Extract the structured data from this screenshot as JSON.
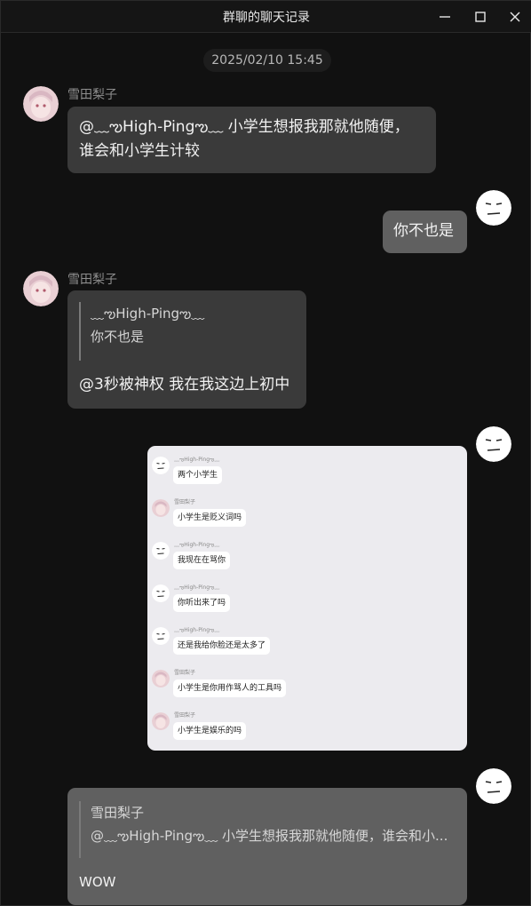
{
  "window": {
    "title": "群聊的聊天记录",
    "controls": {
      "minimize": "minimize-icon",
      "maximize": "maximize-icon",
      "close": "close-icon"
    }
  },
  "chat": {
    "timestamp": "2025/02/10 15:45",
    "messages": [
      {
        "sender": "雪田梨子",
        "line1": "@﹏ఌHigh-Pingఌ﹏ 小学生想报我那就他随便，",
        "line2": "谁会和小学生计较"
      },
      {
        "text": "你不也是"
      },
      {
        "sender": "雪田梨子",
        "quote_name": "﹏ఌHigh-Pingఌ﹏",
        "quote_text": "你不也是",
        "text": "@3秒被神权 我在我这边上初中"
      },
      {
        "screenshot": [
          {
            "name": "﹏ఌHigh-Pingఌ﹏",
            "text": "两个小学生",
            "avatar": "face-icon"
          },
          {
            "name": "雪田梨子",
            "text": "小学生是贬义词吗",
            "avatar": "anime-girl-avatar"
          },
          {
            "name": "﹏ఌHigh-Pingఌ﹏",
            "text": "我现在在骂你",
            "avatar": "face-icon"
          },
          {
            "name": "﹏ఌHigh-Pingఌ﹏",
            "text": "你听出来了吗",
            "avatar": "face-icon"
          },
          {
            "name": "﹏ఌHigh-Pingఌ﹏",
            "text": "还是我给你脸还是太多了",
            "avatar": "face-icon"
          },
          {
            "name": "雪田梨子",
            "text": "小学生是你用作骂人的工具吗",
            "avatar": "anime-girl-avatar"
          },
          {
            "name": "雪田梨子",
            "text": "小学生是娱乐的吗",
            "avatar": "anime-girl-avatar"
          }
        ]
      },
      {
        "quote_name": "雪田梨子",
        "quote_text": "@﹏ఌHigh-Pingఌ﹏ 小学生想报我那就他随便，谁会和小...",
        "text": "WOW"
      }
    ]
  },
  "colors": {
    "background": "#111111",
    "bubble_other": "#3a3a3a",
    "bubble_me": "#606060",
    "screenshot_bg": "#ecebef"
  }
}
